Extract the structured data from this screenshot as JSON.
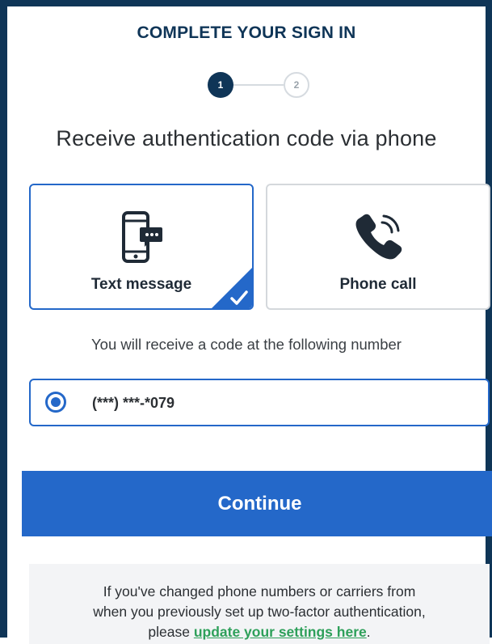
{
  "header": {
    "title": "COMPLETE YOUR SIGN IN"
  },
  "stepper": {
    "steps": [
      {
        "label": "1",
        "state": "active"
      },
      {
        "label": "2",
        "state": "inactive"
      }
    ]
  },
  "page": {
    "heading": "Receive authentication code via phone"
  },
  "options": [
    {
      "label": "Text message",
      "icon": "phone-chat-icon",
      "selected": true
    },
    {
      "label": "Phone call",
      "icon": "phone-ringing-icon",
      "selected": false
    }
  ],
  "number": {
    "info": "You will receive a code at the following number",
    "value": "(***) ***-*079",
    "selected": true
  },
  "actions": {
    "continue_label": "Continue"
  },
  "notice": {
    "line1": "If you've changed phone numbers or carriers from",
    "line2": "when you previously set up two-factor authentication,",
    "prefix": "please ",
    "link_text": "update your settings here",
    "suffix": "."
  },
  "colors": {
    "navy": "#0f3557",
    "primary": "#2468c9",
    "link": "#2ea05a",
    "notice_bg": "#f3f4f6"
  }
}
